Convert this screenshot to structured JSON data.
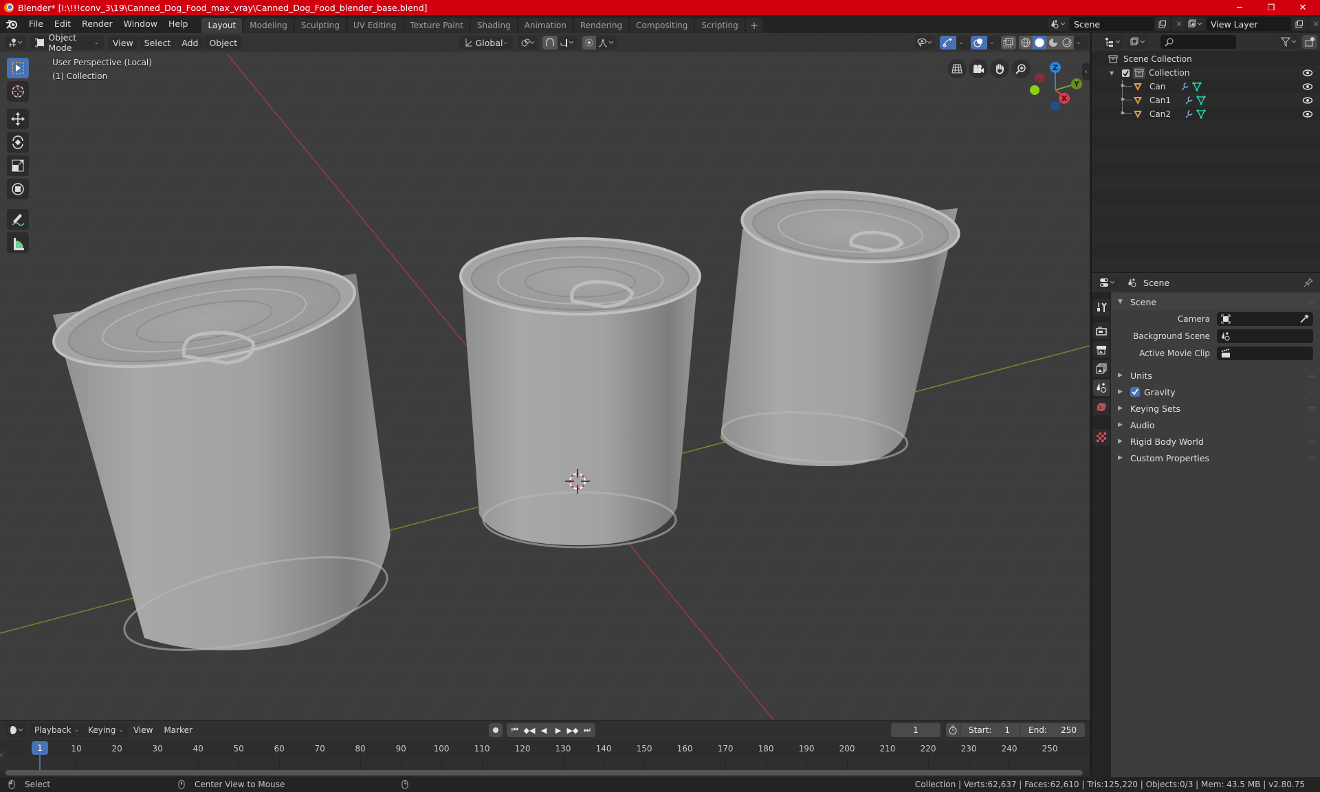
{
  "window": {
    "title": "Blender* [I:\\!!!conv_3\\19\\Canned_Dog_Food_max_vray\\Canned_Dog_Food_blender_base.blend]",
    "controls": {
      "minimize": "─",
      "maximize": "❐",
      "close": "✕"
    }
  },
  "menu": {
    "items": [
      "File",
      "Edit",
      "Render",
      "Window",
      "Help"
    ]
  },
  "workspaces": {
    "tabs": [
      "Layout",
      "Modeling",
      "Sculpting",
      "UV Editing",
      "Texture Paint",
      "Shading",
      "Animation",
      "Rendering",
      "Compositing",
      "Scripting"
    ],
    "active": "Layout",
    "add_label": "+"
  },
  "scene_selector": {
    "value": "Scene"
  },
  "view_layer_selector": {
    "value": "View Layer"
  },
  "viewport": {
    "mode": "Object Mode",
    "menus": [
      "View",
      "Select",
      "Add",
      "Object"
    ],
    "transform_orientation": "Global",
    "overlay_text": {
      "perspective": "User Perspective (Local)",
      "collection": "(1) Collection"
    },
    "gizmo": {
      "x": "X",
      "y": "Y",
      "z": "Z"
    },
    "tools": [
      "select-box",
      "cursor",
      "move",
      "rotate",
      "scale",
      "transform",
      "annotate",
      "measure"
    ],
    "objects": [
      "Can",
      "Can1",
      "Can2"
    ],
    "colors": {
      "x_axis": "#b5404b",
      "y_axis": "#6d9a2a",
      "grid_bg": "#3d3d3d",
      "can": "#a9a9a9"
    }
  },
  "outliner": {
    "search_placeholder": "",
    "root": "Scene Collection",
    "collection": "Collection",
    "objects": [
      {
        "name": "Can"
      },
      {
        "name": "Can1"
      },
      {
        "name": "Can2"
      }
    ]
  },
  "properties": {
    "context": "Scene",
    "panel_title": "Scene",
    "fields": [
      {
        "label": "Camera",
        "value": ""
      },
      {
        "label": "Background Scene",
        "value": ""
      },
      {
        "label": "Active Movie Clip",
        "value": ""
      }
    ],
    "sections": [
      {
        "label": "Units",
        "checkbox": null
      },
      {
        "label": "Gravity",
        "checkbox": true
      },
      {
        "label": "Keying Sets",
        "checkbox": null
      },
      {
        "label": "Audio",
        "checkbox": null
      },
      {
        "label": "Rigid Body World",
        "checkbox": null
      },
      {
        "label": "Custom Properties",
        "checkbox": null
      }
    ],
    "tabs": [
      "tool",
      "render",
      "output",
      "view-layer",
      "scene",
      "world",
      "texture"
    ],
    "active_tab": "scene"
  },
  "timeline": {
    "menus": [
      "Playback",
      "Keying",
      "View",
      "Marker"
    ],
    "current_frame": "1",
    "start_label": "Start:",
    "start": "1",
    "end_label": "End:",
    "end": "250",
    "ticks": [
      "10",
      "20",
      "30",
      "40",
      "50",
      "60",
      "70",
      "80",
      "90",
      "100",
      "110",
      "120",
      "130",
      "140",
      "150",
      "160",
      "170",
      "180",
      "190",
      "200",
      "210",
      "220",
      "230",
      "240",
      "250"
    ],
    "playhead": "1"
  },
  "statusbar": {
    "left_hint": "Select",
    "middle_hint": "Center View to Mouse",
    "stats": "Collection | Verts:62,637 | Faces:62,610 | Tris:125,220 | Objects:0/3 | Mem: 43.5 MB | v2.80.75"
  }
}
